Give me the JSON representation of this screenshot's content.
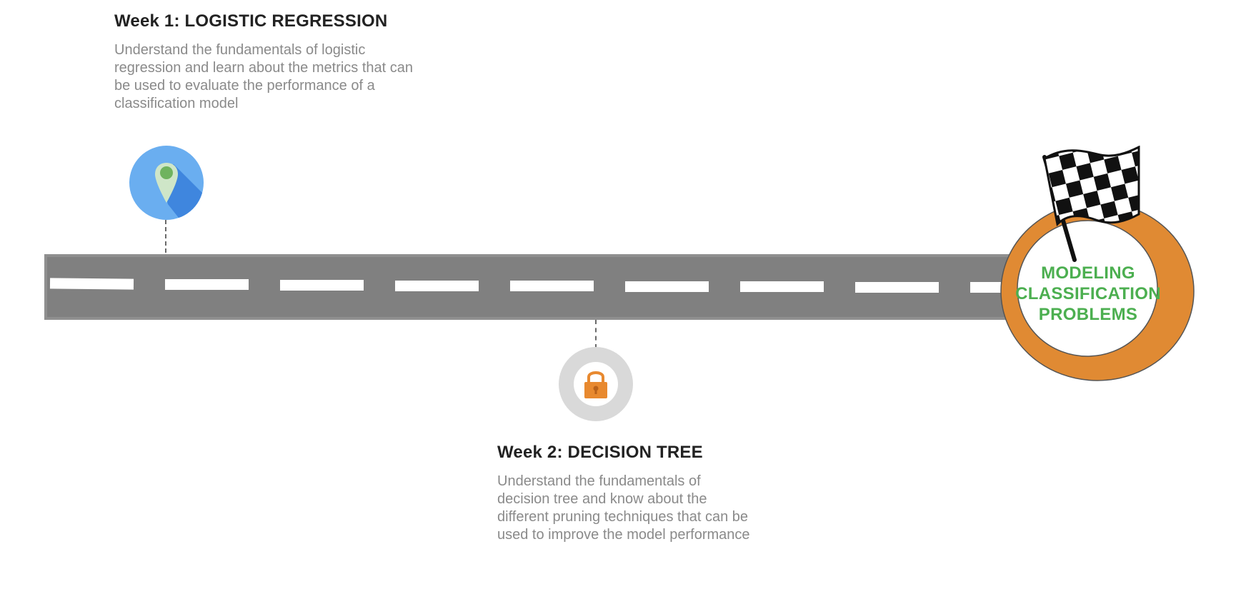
{
  "milestones": [
    {
      "title": "Week 1: LOGISTIC REGRESSION",
      "description": "Understand the fundamentals of logistic regression and learn about the metrics that can be used to evaluate the performance of a classification model",
      "icon": "map-pin-icon",
      "icon_color": "#6aaef0"
    },
    {
      "title": "Week 2: DECISION TREE",
      "description": "Understand the fundamentals of decision tree and know about the different pruning techniques that can be used to improve the model performance",
      "icon": "padlock-icon",
      "icon_color": "#e8892f"
    }
  ],
  "destination": {
    "lines": [
      "MODELING",
      "CLASSIFICATION",
      "PROBLEMS"
    ],
    "icon": "checkered-flag-icon",
    "ring_color": "#e08a33",
    "text_color": "#4caf50"
  },
  "road": {
    "color": "#808080",
    "dash_color": "#ffffff"
  }
}
